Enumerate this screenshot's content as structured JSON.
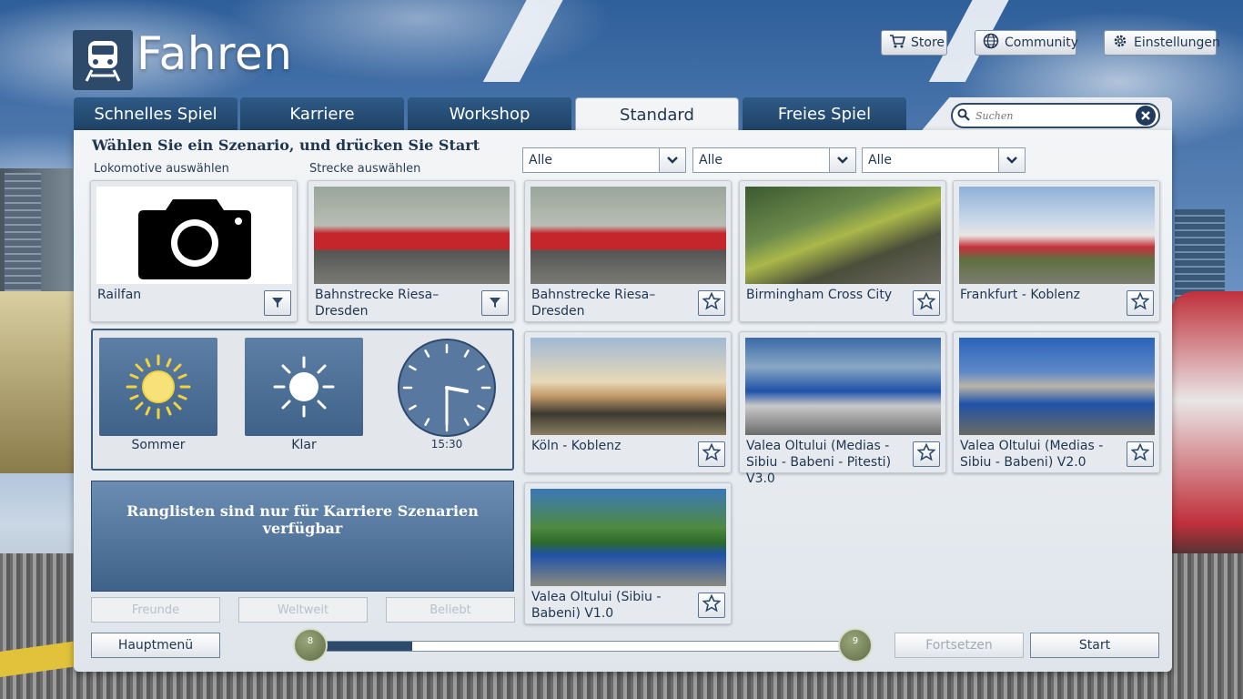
{
  "header": {
    "title": "Fahren",
    "store_label": "Store",
    "community_label": "Community",
    "settings_label": "Einstellungen"
  },
  "tabs": [
    {
      "label": "Schnelles Spiel",
      "active": false
    },
    {
      "label": "Karriere",
      "active": false
    },
    {
      "label": "Workshop",
      "active": false
    },
    {
      "label": "Standard",
      "active": true
    },
    {
      "label": "Freies Spiel",
      "active": false
    }
  ],
  "search": {
    "placeholder": "Suchen"
  },
  "main": {
    "heading": "Wählen Sie ein Szenario, und drücken Sie Start",
    "loco_label": "Lokomotive auswählen",
    "route_label": "Strecke auswählen"
  },
  "filters": [
    {
      "value": "Alle"
    },
    {
      "value": "Alle"
    },
    {
      "value": "Alle"
    }
  ],
  "selection": {
    "loco": {
      "name": "Railfan",
      "icon": "filter-icon"
    },
    "route": {
      "name": "Bahnstrecke Riesa–Dresden",
      "icon": "filter-icon"
    }
  },
  "scenarios": [
    {
      "name": "Bahnstrecke Riesa–Dresden"
    },
    {
      "name": "Birmingham Cross City"
    },
    {
      "name": "Frankfurt - Koblenz"
    },
    {
      "name": "Köln - Koblenz"
    },
    {
      "name": "Valea Oltului (Medias - Sibiu - Babeni - Pitesti) V3.0"
    },
    {
      "name": "Valea Oltului (Medias - Sibiu - Babeni) V2.0"
    },
    {
      "name": "Valea Oltului (Sibiu - Babeni) V1.0"
    }
  ],
  "environment": {
    "season": "Sommer",
    "weather": "Klar",
    "time": "15:30"
  },
  "leaderboard": {
    "message": "Ranglisten sind nur für Karriere Szenarien verfügbar",
    "friends": "Freunde",
    "worldwide": "Weltweit",
    "popular": "Beliebt"
  },
  "footer": {
    "main_menu": "Hauptmenü",
    "continue": "Fortsetzen",
    "start": "Start",
    "page_current": "8",
    "page_next": "9",
    "progress_percent": 17
  },
  "colors": {
    "accent": "#2d4a6b",
    "tab": "#1f4266",
    "panel": "#f3f5f7"
  }
}
